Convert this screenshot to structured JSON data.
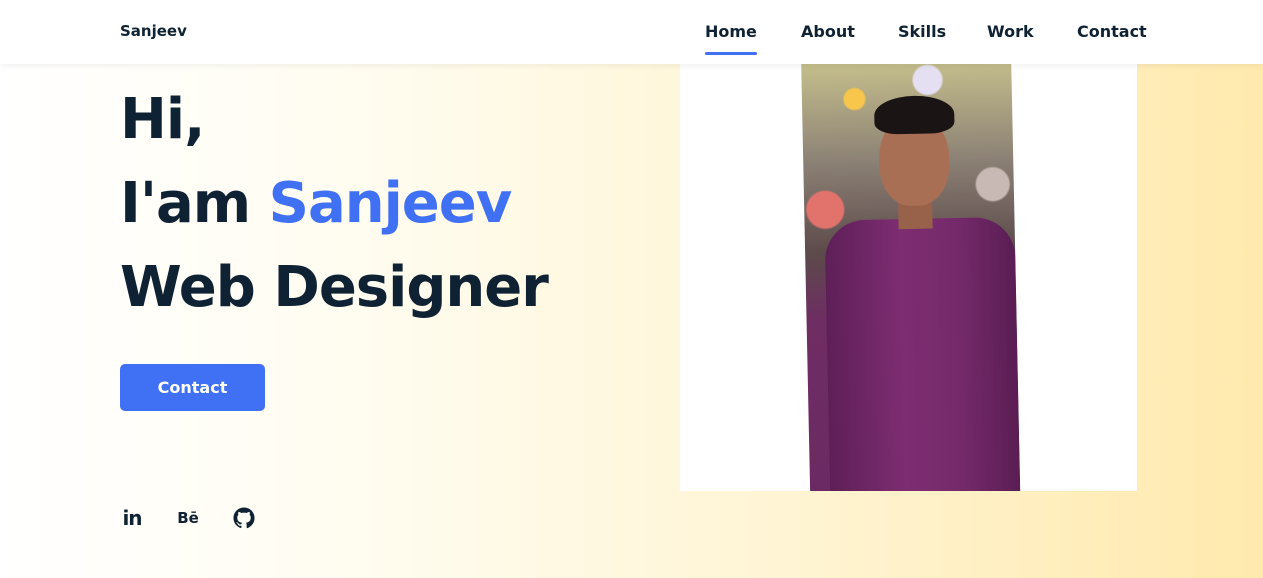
{
  "header": {
    "logo": "Sanjeev",
    "nav": [
      {
        "label": "Home",
        "active": true
      },
      {
        "label": "About",
        "active": false
      },
      {
        "label": "Skills",
        "active": false
      },
      {
        "label": "Work",
        "active": false
      },
      {
        "label": "Contact",
        "active": false
      }
    ]
  },
  "hero": {
    "line1": "Hi,",
    "line2_prefix": "I'am ",
    "line2_name": "Sanjeev",
    "line3": "Web Designer",
    "button_label": "Contact"
  },
  "social": [
    {
      "label": "in",
      "icon": "linkedin-icon"
    },
    {
      "label": "Bē",
      "icon": "behance-icon"
    },
    {
      "label": "",
      "icon": "github-icon"
    }
  ],
  "colors": {
    "accent": "#4070f4",
    "text": "#0f2233"
  }
}
